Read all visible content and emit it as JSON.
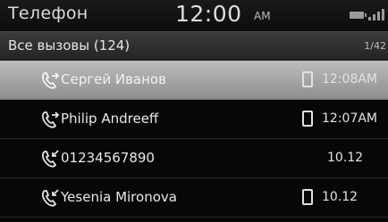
{
  "status": {
    "title": "Телефон",
    "time": "12:00",
    "ampm": "AM"
  },
  "header": {
    "title": "Все вызовы (124)",
    "page": "1/42"
  },
  "calls": [
    {
      "name": "Сергей Иванов",
      "type": "outgoing",
      "device_icon": "phone-icon",
      "time": "12:08AM",
      "selected": true
    },
    {
      "name": "Philip Andreeff",
      "type": "outgoing",
      "device_icon": "phone-icon",
      "time": "12:07AM",
      "selected": false
    },
    {
      "name": "01234567890",
      "type": "incoming",
      "device_icon": "",
      "time": "10.12",
      "selected": false
    },
    {
      "name": "Yesenia Mironova",
      "type": "incoming",
      "device_icon": "phone-icon",
      "time": "10.12",
      "selected": false
    }
  ]
}
